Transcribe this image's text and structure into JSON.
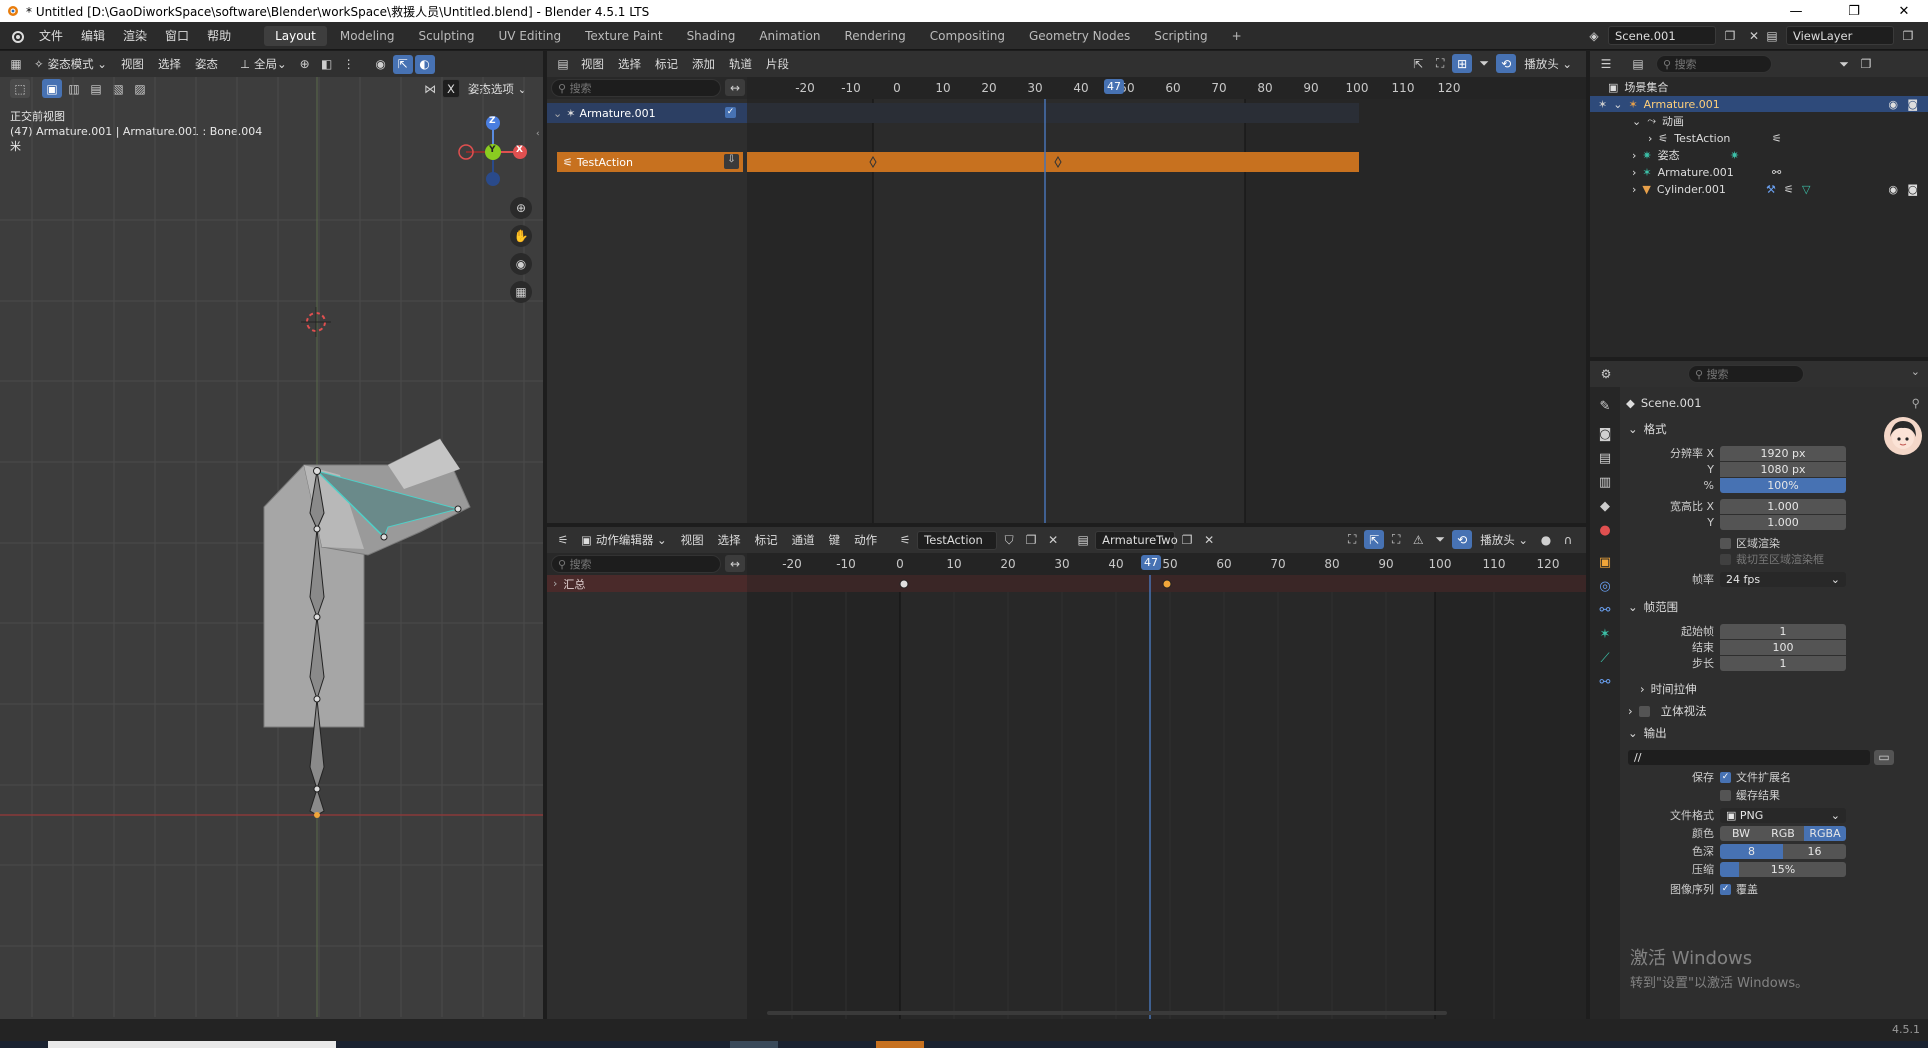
{
  "window": {
    "title": "* Untitled [D:\\GaoDiworkSpace\\software\\Blender\\workSpace\\救援人员\\Untitled.blend] - Blender 4.5.1 LTS",
    "minimize": "—",
    "maximize": "❐",
    "close": "✕"
  },
  "menu": {
    "items": [
      "文件",
      "编辑",
      "渲染",
      "窗口",
      "帮助"
    ]
  },
  "workspaces": {
    "tabs": [
      "Layout",
      "Modeling",
      "Sculpting",
      "UV Editing",
      "Texture Paint",
      "Shading",
      "Animation",
      "Rendering",
      "Compositing",
      "Geometry Nodes",
      "Scripting"
    ],
    "active": "Layout",
    "add": "+",
    "scene": "Scene.001",
    "view_layer": "ViewLayer"
  },
  "viewport": {
    "mode": "姿态模式",
    "menus": [
      "视图",
      "选择",
      "姿态"
    ],
    "transform": "全局",
    "pose_options": "姿态选项",
    "x_toggle": "X",
    "view_name": "正交前视图",
    "info": "(47) Armature.001 | Armature.001 : Bone.004",
    "unit": "米",
    "axis_labels": {
      "z": "Z",
      "y": "Y",
      "x": "X"
    }
  },
  "nla": {
    "menus": [
      "视图",
      "选择",
      "标记",
      "添加",
      "轨道",
      "片段"
    ],
    "search_placeholder": "搜索",
    "playhead": "播放头",
    "ruler": [
      "-20",
      "-10",
      "0",
      "10",
      "20",
      "30",
      "40",
      "50",
      "60",
      "70",
      "80",
      "90",
      "100",
      "110",
      "120"
    ],
    "current_frame": "47",
    "track": "Armature.001",
    "strip": "TestAction"
  },
  "action_editor": {
    "mode": "动作编辑器",
    "menus": [
      "视图",
      "选择",
      "标记",
      "通道",
      "键",
      "动作"
    ],
    "action": "TestAction",
    "armature": "ArmatureTwo",
    "playhead": "播放头",
    "search_placeholder": "搜索",
    "ruler": [
      "-20",
      "-10",
      "0",
      "10",
      "20",
      "30",
      "40",
      "50",
      "60",
      "70",
      "80",
      "90",
      "100",
      "110",
      "120"
    ],
    "current_frame": "47",
    "summary": "汇总"
  },
  "outliner": {
    "search_placeholder": "搜索",
    "rows": {
      "collection": "场景集合",
      "armature": "Armature.001",
      "animation": "动画",
      "action": "TestAction",
      "pose": "姿态",
      "armature_data": "Armature.001",
      "cylinder": "Cylinder.001"
    }
  },
  "properties": {
    "search_placeholder": "搜索",
    "scene": "Scene.001",
    "format": {
      "title": "格式",
      "res_x_label": "分辨率 X",
      "res_x": "1920 px",
      "res_y_label": "Y",
      "res_y": "1080 px",
      "pct_label": "%",
      "pct": "100%",
      "aspect_x_label": "宽高比 X",
      "aspect_x": "1.000",
      "aspect_y_label": "Y",
      "aspect_y": "1.000",
      "border": "区域渲染",
      "crop": "裁切至区域渲染框",
      "fps_label": "帧率",
      "fps": "24 fps"
    },
    "frame_range": {
      "title": "帧范围",
      "start_label": "起始帧",
      "start": "1",
      "end_label": "结束",
      "end": "100",
      "step_label": "步长",
      "step": "1",
      "time_stretch": "时间拉伸"
    },
    "stereo": "立体视法",
    "output": {
      "title": "输出",
      "path": "//",
      "save_label": "保存",
      "file_ext": "文件扩展名",
      "cache": "缓存结果",
      "format_label": "文件格式",
      "format": "PNG",
      "color_label": "颜色",
      "color_opts": [
        "BW",
        "RGB",
        "RGBA"
      ],
      "depth_label": "色深",
      "depth_opts": [
        "8",
        "16"
      ],
      "compress_label": "压缩",
      "compress": "15%",
      "seq_label": "图像序列",
      "overwrite": "覆盖"
    }
  },
  "watermark": {
    "line1": "激活 Windows",
    "line2": "转到\"设置\"以激活 Windows。"
  },
  "version": "4.5.1",
  "colors": {
    "accent": "#4772b3",
    "nla_strip": "#c7711f",
    "track_bg": "#2a3a5a",
    "summary_bg": "#4a2a2a",
    "keyframe_sel": "#f0a53a"
  }
}
